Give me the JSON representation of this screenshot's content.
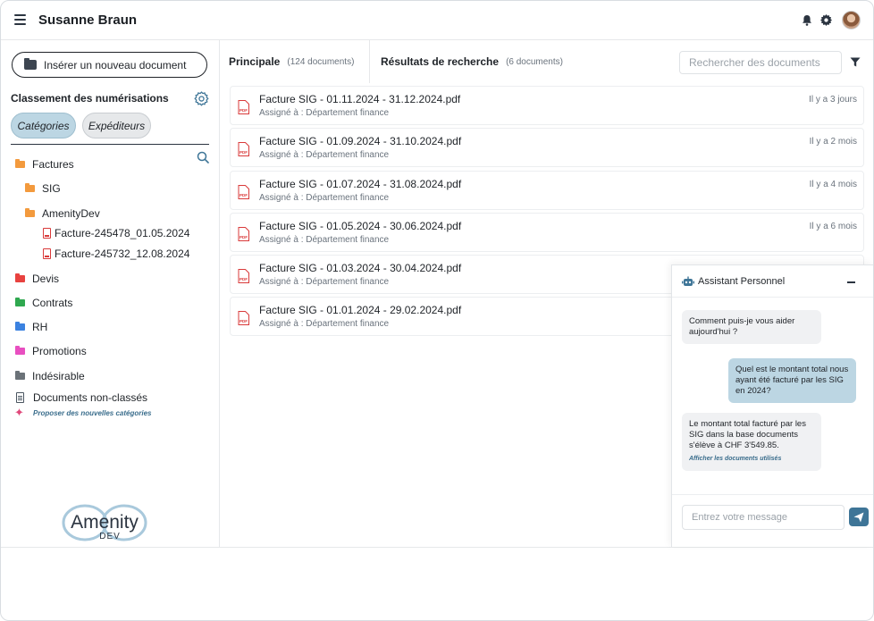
{
  "header": {
    "user_name": "Susanne Braun"
  },
  "sidebar": {
    "insert_label": "Insérer un nouveau document",
    "classification_title": "Classement des numérisations",
    "chips": {
      "categories": "Catégories",
      "senders": "Expéditeurs"
    },
    "tree": {
      "factures": "Factures",
      "sig": "SIG",
      "amenitydev": "AmenityDev",
      "file1": "Facture-245478_01.05.2024",
      "file2": "Facture-245732_12.08.2024",
      "devis": "Devis",
      "contrats": "Contrats",
      "rh": "RH",
      "promotions": "Promotions",
      "indesirable": "Indésirable",
      "non_classes": "Documents non-classés"
    },
    "propose_label": "Proposer des nouvelles catégories",
    "logo_text": {
      "top": "Amenity",
      "bottom": "DEV"
    }
  },
  "main": {
    "tabs": {
      "principal": {
        "label": "Principale",
        "count": "(124 documents)"
      },
      "results": {
        "label": "Résultats de recherche",
        "count": "(6 documents)"
      }
    },
    "search_placeholder": "Rechercher des documents",
    "documents": [
      {
        "title": "Facture SIG - 01.11.2024 - 31.12.2024.pdf",
        "assigned": "Assigné à : Département finance",
        "time": "Il y a 3 jours"
      },
      {
        "title": "Facture SIG - 01.09.2024 - 31.10.2024.pdf",
        "assigned": "Assigné à : Département finance",
        "time": "Il y a 2 mois"
      },
      {
        "title": "Facture SIG - 01.07.2024 - 31.08.2024.pdf",
        "assigned": "Assigné à : Département finance",
        "time": "Il y a 4 mois"
      },
      {
        "title": "Facture SIG - 01.05.2024 - 30.06.2024.pdf",
        "assigned": "Assigné à : Département finance",
        "time": "Il y a 6 mois"
      },
      {
        "title": "Facture SIG - 01.03.2024 - 30.04.2024.pdf",
        "assigned": "Assigné à : Département finance",
        "time": ""
      },
      {
        "title": "Facture SIG - 01.01.2024 - 29.02.2024.pdf",
        "assigned": "Assigné à : Département finance",
        "time": ""
      }
    ]
  },
  "chat": {
    "title": "Assistant Personnel",
    "bot_greeting": "Comment puis-je vous aider aujourd'hui ?",
    "user_question": "Quel est le montant total nous ayant été facturé par les SIG en 2024?",
    "bot_answer": "Le montant total facturé par les SIG dans la base documents s'élève à CHF 3'549.85.",
    "bot_link": "Afficher les documents utilisés",
    "input_placeholder": "Entrez votre message"
  },
  "colors": {
    "factures": "#f39a3d",
    "devis": "#e8423f",
    "contrats": "#2fa84f",
    "rh": "#3b82e0",
    "promotions": "#e84fc0",
    "indesirable": "#6b7278",
    "accent": "#3e7597",
    "chip_active": "#bcd6e3"
  }
}
